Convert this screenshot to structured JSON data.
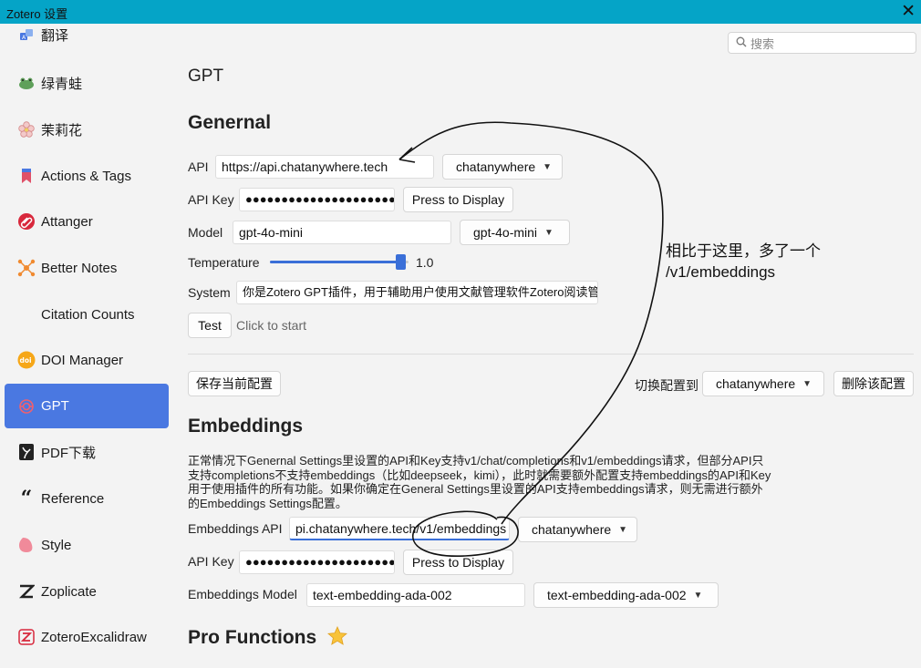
{
  "window": {
    "title": "Zotero 设置",
    "close_glyph": "✕"
  },
  "search": {
    "placeholder": "搜索",
    "icon": "search-icon"
  },
  "sidebar": {
    "items": [
      {
        "label": "翻译",
        "icon": "translate-icon"
      },
      {
        "label": "绿青蛙",
        "icon": "frog-icon"
      },
      {
        "label": "茉莉花",
        "icon": "jasmine-flower-icon"
      },
      {
        "label": "Actions & Tags",
        "icon": "bookmark-icon"
      },
      {
        "label": "Attanger",
        "icon": "paperclip-icon"
      },
      {
        "label": "Better Notes",
        "icon": "notes-network-icon"
      },
      {
        "label": "Citation Counts",
        "icon": ""
      },
      {
        "label": "DOI Manager",
        "icon": "doi-icon"
      },
      {
        "label": "GPT",
        "icon": "openai-icon",
        "active": true
      },
      {
        "label": "PDF下载",
        "icon": "pdf-download-icon"
      },
      {
        "label": "Reference",
        "icon": "quote-icon"
      },
      {
        "label": "Style",
        "icon": "palette-icon"
      },
      {
        "label": "Zoplicate",
        "icon": "zoplicate-icon"
      },
      {
        "label": "ZoteroExcalidraw",
        "icon": "excalidraw-icon"
      }
    ],
    "active_color": "#4a78e1"
  },
  "page_title": "GPT",
  "general": {
    "heading": "Genernal",
    "api_label": "API",
    "api_value": "https://api.chatanywhere.tech",
    "api_select": "chatanywhere",
    "apikey_label": "API Key",
    "apikey_value": "●●●●●●●●●●●●●●●●●●●●●●",
    "display_button": "Press to Display",
    "model_label": "Model",
    "model_value": "gpt-4o-mini",
    "model_select": "gpt-4o-mini",
    "temperature_label": "Temperature",
    "temperature_value": "1.0",
    "temperature_fraction": 0.94,
    "system_label": "System",
    "system_value": "你是Zotero GPT插件，用于辅助用户使用文献管理软件Zotero阅读管理",
    "test_button": "Test",
    "test_status": "Click to start"
  },
  "config": {
    "save_button": "保存当前配置",
    "switch_label": "切换配置到",
    "switch_select": "chatanywhere",
    "delete_button": "删除该配置"
  },
  "embeddings": {
    "heading": "Embeddings",
    "description": "正常情况下Genernal Settings里设置的API和Key支持v1/chat/completions和v1/embeddings请求，但部分API只支持completions不支持embeddings（比如deepseek，kimi），此时就需要额外配置支持embeddings的API和Key用于使用插件的所有功能。如果你确定在General Settings里设置的API支持embeddings请求，则无需进行额外的Embeddings Settings配置。",
    "api_label": "Embeddings API",
    "api_value": "pi.chatanywhere.tech/v1/embeddings",
    "api_select": "chatanywhere",
    "apikey_label": "API Key",
    "apikey_value": "●●●●●●●●●●●●●●●●●●●●●●",
    "display_button": "Press to Display",
    "model_label": "Embeddings Model",
    "model_value": "text-embedding-ada-002",
    "model_select": "text-embedding-ada-002"
  },
  "pro": {
    "heading": "Pro Functions",
    "icon": "star-icon"
  },
  "annotation": {
    "line1": "相比于这里，多了一个",
    "line2": "/v1/embeddings"
  },
  "chevron": "⌄"
}
